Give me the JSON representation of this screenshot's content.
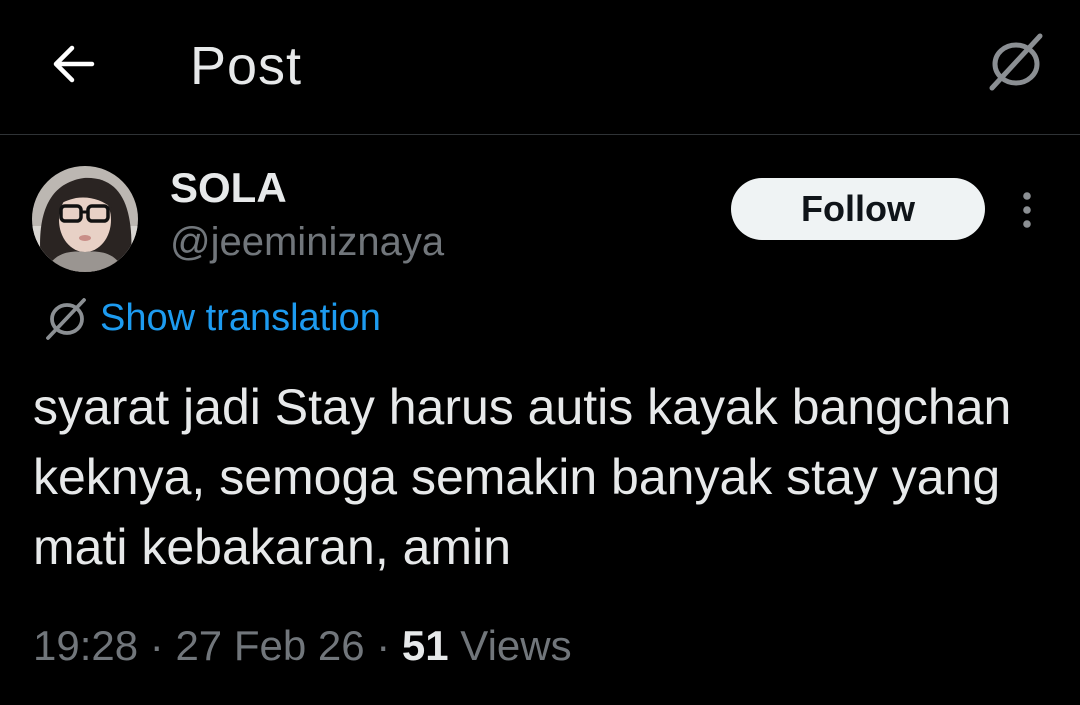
{
  "header": {
    "title": "Post",
    "back_icon": "arrow-left-icon",
    "translate_icon": "translate-icon"
  },
  "post": {
    "author": {
      "display_name": "SOLA",
      "handle": "@jeeminiznaya",
      "avatar": "avatar-photo"
    },
    "follow_label": "Follow",
    "more_icon": "more-vertical-icon",
    "show_translation_label": "Show translation",
    "text": "syarat jadi Stay harus autis kayak bangchan keknya, semoga semakin banyak stay yang mati kebakaran, amin",
    "meta": {
      "time": "19:28",
      "separator": " · ",
      "date": "27 Feb 26",
      "views_count": "51",
      "views_label": " Views"
    }
  },
  "colors": {
    "background": "#000000",
    "text_primary": "#e7e9ea",
    "text_secondary": "#71767b",
    "accent": "#1d9bf0",
    "follow_bg": "#eff3f4",
    "divider": "#2f3336"
  }
}
